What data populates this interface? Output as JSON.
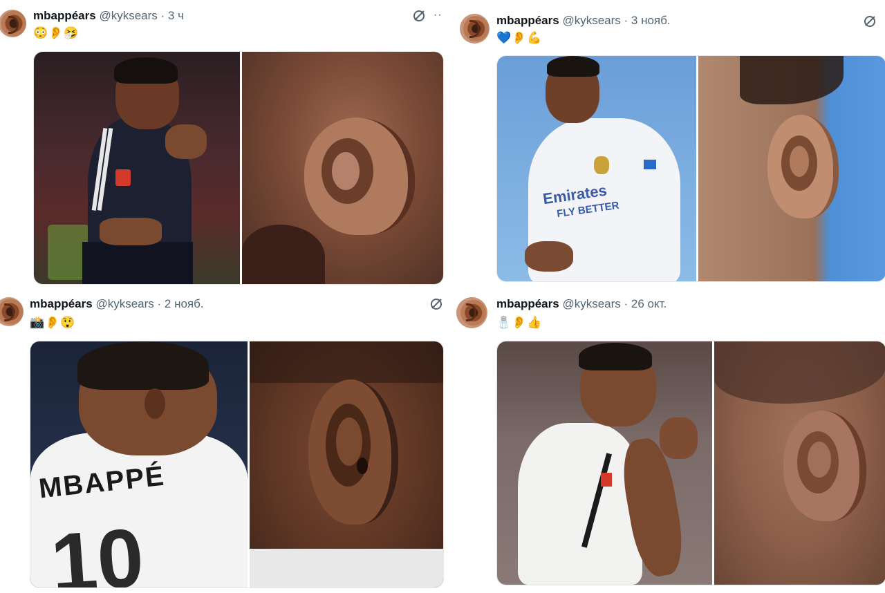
{
  "tweets": [
    {
      "name": "mbappéars",
      "handle": "@kyksears",
      "sep": "·",
      "time": "3 ч",
      "emojis": "😳👂🤧",
      "more": "··"
    },
    {
      "name": "mbappéars",
      "handle": "@kyksears",
      "sep": "·",
      "time": "3 нояб.",
      "emojis": "💙👂💪"
    },
    {
      "name": "mbappéars",
      "handle": "@kyksears",
      "sep": "·",
      "time": "2 нояб.",
      "emojis": "📸👂😲",
      "jersey_name": "MBAPPÉ",
      "jersey_number": "10"
    },
    {
      "name": "mbappéars",
      "handle": "@kyksears",
      "sep": "·",
      "time": "26 окт.",
      "emojis": "🧂👂👍"
    }
  ],
  "jersey_sponsor_1": "Emirates",
  "jersey_sponsor_2": "FLY BETTER",
  "icons": {
    "grok": "grok-icon",
    "more": "more-icon",
    "avatar": "avatar"
  },
  "colors": {
    "text_primary": "#0f1419",
    "text_secondary": "#536471",
    "media_border": "#e6e6e6"
  }
}
